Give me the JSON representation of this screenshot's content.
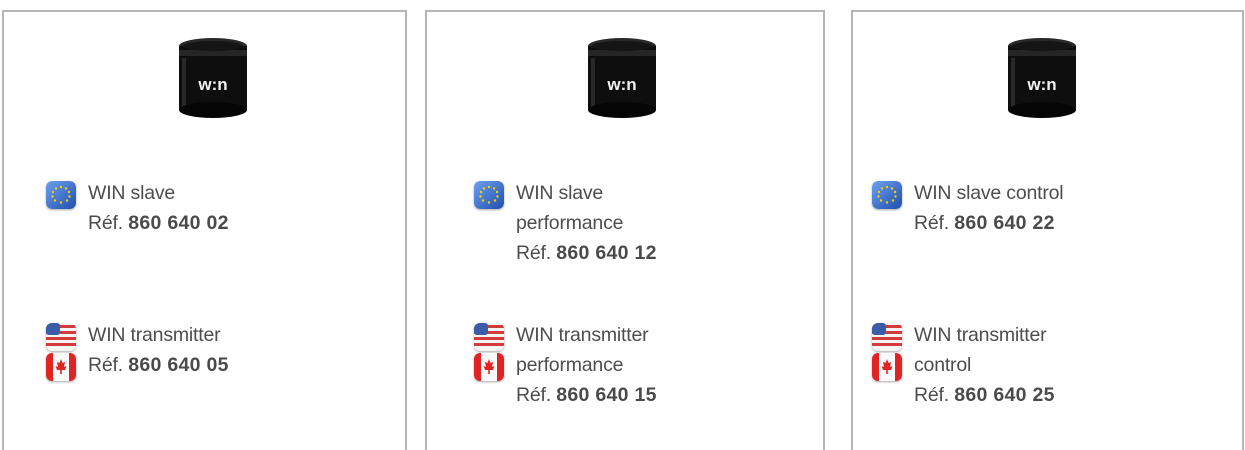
{
  "ref_prefix": "Réf.",
  "logo_text": "w:n",
  "products": [
    {
      "eu": {
        "name_lines": [
          "WIN slave"
        ],
        "ref": "860 640 02"
      },
      "na": {
        "name_lines": [
          "WIN transmitter"
        ],
        "ref": "860 640 05"
      }
    },
    {
      "eu": {
        "name_lines": [
          "WIN slave",
          "performance"
        ],
        "ref": "860 640 12"
      },
      "na": {
        "name_lines": [
          "WIN transmitter",
          "performance"
        ],
        "ref": "860 640 15"
      }
    },
    {
      "eu": {
        "name_lines": [
          "WIN slave control"
        ],
        "ref": "860 640 22"
      },
      "na": {
        "name_lines": [
          "WIN transmitter",
          "control"
        ],
        "ref": "860 640 25"
      }
    }
  ],
  "icons": {
    "eu_flag": "eu-flag-icon",
    "us_flag": "us-flag-icon",
    "canada_flag": "canada-flag-icon",
    "product": "win-module-image"
  },
  "colors": {
    "card_border": "#b6b6b6",
    "text": "#4d4d4d",
    "eu_blue": "#2f66c6",
    "us_red": "#d33a3a",
    "canada_red": "#e02424"
  }
}
